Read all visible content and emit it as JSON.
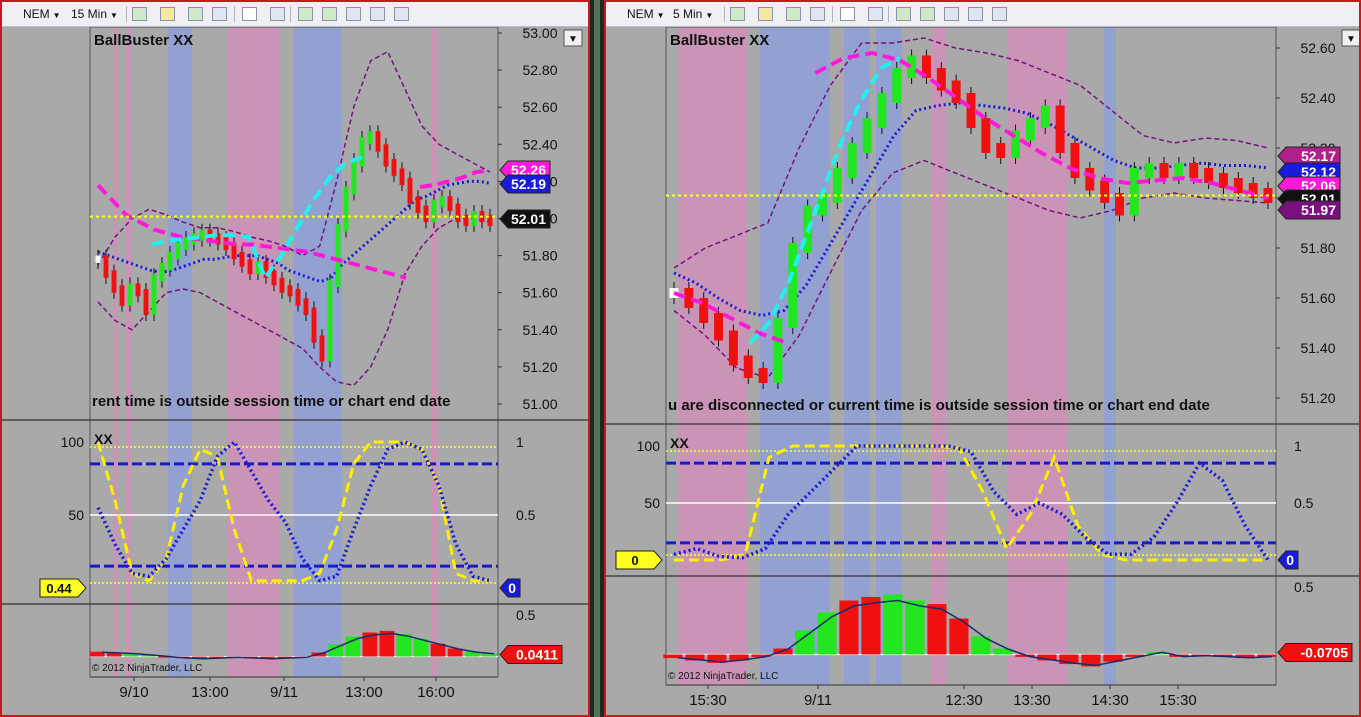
{
  "toolbar": {
    "left": {
      "instrument": "NEM",
      "interval": "15 Min"
    },
    "right": {
      "instrument": "NEM",
      "interval": "5 Min"
    },
    "icons": [
      "bar-style-icon",
      "draw-pencil-icon",
      "add-indicator-icon",
      "strategy-icon",
      "crosshair-icon",
      "zoom-icon",
      "data-box-icon",
      "chart-trader-icon",
      "properties-icon",
      "money-icon",
      "template-icon"
    ]
  },
  "colors": {
    "background": "#a9a9a9",
    "up_bar": "#22e61e",
    "down_bar": "#f01010",
    "neutral_bar": "#ffffff",
    "magenta_line": "#ff1ad9",
    "cyan_line": "#22f0f0",
    "blue_dots": "#1a1ad9",
    "purple_band": "#7a1080",
    "yellow_line": "#ffee00",
    "price_line": "#ffff30",
    "pink_shade": "#d090b8",
    "blue_shade": "#8fa0d8"
  },
  "chart_data": [
    {
      "type": "line",
      "panel": "left",
      "title": "BallBuster XX",
      "message": "rent time is outside session time or chart end date",
      "copyright": "© 2012 NinjaTrader, LLC",
      "x_tick_labels": [
        "9/10",
        "13:00",
        "9/11",
        "13:00",
        "16:00"
      ],
      "price_axis": {
        "ticks": [
          "53.00",
          "52.80",
          "52.60",
          "52.40",
          "52.20",
          "52.00",
          "51.80",
          "51.60",
          "51.40",
          "51.20",
          "51.00"
        ],
        "ylim": [
          51.0,
          53.0
        ]
      },
      "price_markers": [
        {
          "label": "52.26",
          "value": 52.26,
          "color": "#ff1ad9"
        },
        {
          "label": "52.19",
          "value": 52.19,
          "color": "#1a1ad9"
        },
        {
          "label": "52.01",
          "value": 52.01,
          "color": "#111111"
        }
      ],
      "current_price": 52.01,
      "price_series": {
        "close": [
          51.78,
          51.7,
          51.62,
          51.55,
          51.63,
          51.6,
          51.5,
          51.68,
          51.74,
          51.8,
          51.85,
          51.88,
          51.9,
          51.92,
          51.9,
          51.88,
          51.85,
          51.8,
          51.76,
          51.72,
          51.75,
          51.7,
          51.66,
          51.62,
          51.6,
          51.55,
          51.5,
          51.35,
          51.25,
          51.65,
          51.95,
          52.15,
          52.3,
          52.42,
          52.45,
          52.38,
          52.3,
          52.25,
          52.2,
          52.1,
          52.05,
          52.0,
          52.08,
          52.1,
          52.06,
          52.0,
          51.98,
          52.02,
          52.0,
          51.98
        ],
        "magenta": [
          52.18,
          52.1,
          52.02,
          51.98,
          51.94,
          51.92,
          51.9,
          51.89,
          51.88,
          51.87,
          51.86,
          51.86,
          51.85,
          51.84,
          51.83,
          51.82,
          51.8,
          51.78,
          51.76,
          51.74,
          51.72,
          51.7,
          51.68,
          52.17,
          52.18,
          52.2,
          52.22,
          52.25,
          52.26
        ],
        "cyan": [
          51.86,
          51.88,
          51.89,
          51.9,
          51.91,
          51.91,
          51.9,
          51.68,
          51.8,
          51.95,
          52.1,
          52.22,
          52.3,
          52.33
        ],
        "blue_dots": [
          51.82,
          51.8,
          51.78,
          51.76,
          51.74,
          51.72,
          51.71,
          51.72,
          51.74,
          51.76,
          51.78,
          51.78,
          51.79,
          51.8,
          51.8,
          51.8,
          51.78,
          51.76,
          51.72,
          51.7,
          51.68,
          51.66,
          51.68,
          51.75,
          51.8,
          51.85,
          51.9,
          51.95,
          52.0,
          52.05,
          52.1,
          52.12,
          52.15,
          52.18,
          52.19,
          52.2,
          52.2,
          52.19
        ],
        "band_upper": [
          51.75,
          51.9,
          52.0,
          52.05,
          52.02,
          51.98,
          51.95,
          51.95,
          51.93,
          51.9,
          51.88,
          51.85,
          51.8,
          51.85,
          52.2,
          52.6,
          52.85,
          52.9,
          52.7,
          52.5,
          52.4,
          52.35,
          52.3,
          52.25
        ],
        "band_lower": [
          51.55,
          51.45,
          51.4,
          51.5,
          51.6,
          51.62,
          51.6,
          51.55,
          51.5,
          51.45,
          51.4,
          51.35,
          51.3,
          51.2,
          51.12,
          51.1,
          51.2,
          51.4,
          51.7,
          51.85,
          51.95,
          52.0,
          52.0,
          51.98
        ]
      },
      "oscillator_1": {
        "label": "XX",
        "left_axis": [
          "100",
          "50"
        ],
        "right_axis": [
          "1",
          "0.5"
        ],
        "marker_left": "0.44",
        "marker_right": "0",
        "levels": [
          85,
          15
        ],
        "yellow": [
          100,
          60,
          10,
          5,
          20,
          70,
          95,
          90,
          40,
          5,
          5,
          5,
          5,
          10,
          40,
          85,
          100,
          100,
          100,
          95,
          70,
          10,
          5,
          5
        ],
        "blue_dots": [
          55,
          30,
          10,
          8,
          20,
          40,
          60,
          90,
          100,
          80,
          60,
          45,
          20,
          5,
          8,
          40,
          70,
          95,
          100,
          95,
          70,
          30,
          8,
          5
        ]
      },
      "oscillator_2": {
        "right_axis": [
          "0.5"
        ],
        "marker_value": "0.0411",
        "histogram": [
          0.06,
          0.05,
          0.04,
          0.02,
          0.0,
          -0.02,
          -0.03,
          -0.02,
          -0.01,
          -0.02,
          -0.03,
          -0.02,
          -0.01,
          0.05,
          0.15,
          0.25,
          0.3,
          0.32,
          0.28,
          0.22,
          0.16,
          0.1,
          0.06,
          0.04
        ]
      }
    },
    {
      "type": "line",
      "panel": "right",
      "title": "BallBuster XX",
      "message": "u are disconnected or current time is outside session time or chart end date",
      "copyright": "© 2012 NinjaTrader, LLC",
      "x_tick_labels": [
        "15:30",
        "9/11",
        "12:30",
        "13:30",
        "14:30",
        "15:30"
      ],
      "price_axis": {
        "ticks": [
          "52.60",
          "52.40",
          "52.20",
          "52.00",
          "51.80",
          "51.60",
          "51.40",
          "51.20"
        ],
        "ylim": [
          51.16,
          52.66
        ]
      },
      "price_markers": [
        {
          "label": "52.17",
          "value": 52.17,
          "color": "#b0208a"
        },
        {
          "label": "52.12",
          "value": 52.12,
          "color": "#1a1ad9"
        },
        {
          "label": "52.06",
          "value": 52.06,
          "color": "#ff1ad9"
        },
        {
          "label": "52.01",
          "value": 52.01,
          "color": "#111111"
        },
        {
          "label": "51.97",
          "value": 51.97,
          "color": "#7a1080"
        }
      ],
      "current_price": 52.01,
      "price_series": {
        "close": [
          51.62,
          51.58,
          51.52,
          51.45,
          51.35,
          51.3,
          51.28,
          51.5,
          51.8,
          51.95,
          52.0,
          52.1,
          52.2,
          52.3,
          52.4,
          52.5,
          52.55,
          52.5,
          52.45,
          52.4,
          52.3,
          52.2,
          52.18,
          52.25,
          52.3,
          52.35,
          52.2,
          52.1,
          52.05,
          52.0,
          51.95,
          52.1,
          52.12,
          52.1,
          52.12,
          52.1,
          52.08,
          52.06,
          52.04,
          52.02,
          52.0
        ],
        "magenta": [
          51.62,
          51.58,
          51.52,
          51.46,
          51.42,
          52.5,
          52.56,
          52.58,
          52.55,
          52.48,
          52.4,
          52.32,
          52.25,
          52.18,
          52.12,
          52.08,
          52.06,
          52.07,
          52.08,
          52.06,
          52.03,
          52.0
        ],
        "cyan": [
          51.42,
          51.5,
          51.65,
          51.85,
          52.05,
          52.25,
          52.4,
          52.52,
          52.56
        ],
        "blue_dots": [
          51.7,
          51.66,
          51.6,
          51.55,
          51.53,
          51.55,
          51.65,
          51.8,
          51.95,
          52.1,
          52.25,
          52.35,
          52.37,
          52.38,
          52.37,
          52.36,
          52.34,
          52.3,
          52.25,
          52.2,
          52.15,
          52.12,
          52.12,
          52.13,
          52.14,
          52.13,
          52.13,
          52.12
        ],
        "band_upper": [
          51.72,
          51.8,
          51.85,
          51.9,
          52.2,
          52.45,
          52.62,
          52.62,
          52.64,
          52.6,
          52.58,
          52.55,
          52.5,
          52.45,
          52.35,
          52.25,
          52.22,
          52.24,
          52.23,
          52.2
        ],
        "band_lower": [
          51.55,
          51.45,
          51.32,
          51.28,
          51.45,
          51.7,
          51.95,
          52.1,
          52.15,
          52.1,
          52.05,
          52.0,
          51.95,
          51.92,
          51.95,
          52.0,
          52.02,
          52.0,
          51.99,
          51.98
        ]
      },
      "oscillator_1": {
        "label": "XX",
        "left_axis": [
          "100",
          "50"
        ],
        "right_axis": [
          "1",
          "0.5"
        ],
        "marker_left": "0",
        "marker_right": "0",
        "levels": [
          85,
          15
        ],
        "yellow": [
          0,
          0,
          0,
          5,
          90,
          100,
          100,
          100,
          100,
          100,
          100,
          100,
          98,
          60,
          10,
          40,
          90,
          30,
          5,
          0,
          0,
          0,
          0,
          0,
          0,
          0
        ],
        "blue_dots": [
          5,
          10,
          3,
          2,
          10,
          40,
          60,
          80,
          100,
          100,
          100,
          100,
          100,
          95,
          60,
          40,
          50,
          40,
          20,
          5,
          5,
          20,
          50,
          85,
          70,
          30,
          0
        ]
      },
      "oscillator_2": {
        "right_axis": [
          "0.5"
        ],
        "marker_value": "-0.0705",
        "histogram": [
          -0.03,
          -0.05,
          -0.07,
          -0.05,
          -0.02,
          0.05,
          0.2,
          0.35,
          0.45,
          0.48,
          0.5,
          0.45,
          0.42,
          0.3,
          0.15,
          0.05,
          -0.02,
          -0.05,
          -0.08,
          -0.1,
          -0.06,
          -0.02,
          0.02,
          -0.02,
          -0.01,
          -0.02,
          -0.03,
          -0.02
        ]
      }
    }
  ]
}
